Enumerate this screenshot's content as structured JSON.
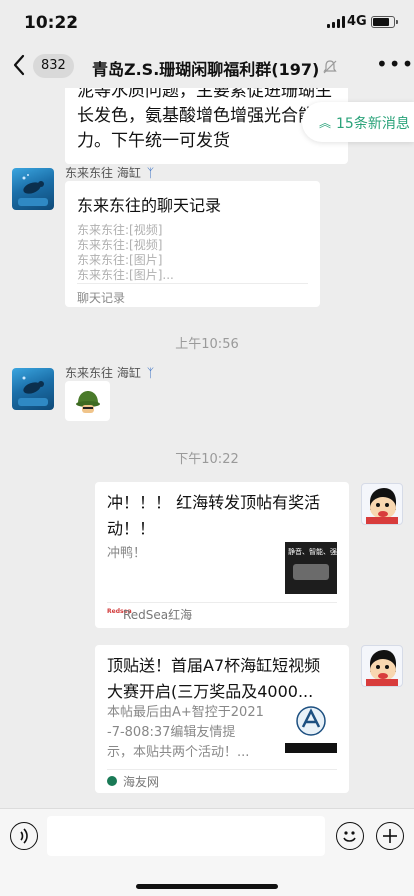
{
  "status": {
    "time": "10:22",
    "network": "4G"
  },
  "header": {
    "unread_count": "832",
    "title": "青岛Z.S.珊瑚闲聊福利群(197)"
  },
  "new_messages": {
    "label": "15条新消息"
  },
  "messages": {
    "top_bubble": {
      "line1": "泥等水质问题，主要累促进珊瑚生",
      "line2": "长发色，氨基酸增色增强光合能",
      "line3": "力。下午统一可发货"
    },
    "forward": {
      "sender": "东来东往 海缸",
      "title": "东来东往的聊天记录",
      "lines": [
        "东来东往:[视频]",
        "东来东往:[视频]",
        "东来东往:[图片]",
        "东来东往:[图片]..."
      ],
      "footer": "聊天记录"
    },
    "time1": "上午10:56",
    "emoji_msg": {
      "sender": "东来东往 海缸"
    },
    "time2": "下午10:22",
    "link1": {
      "title": "冲！！！ 红海转发顶帖有奖活动！！",
      "desc": "冲鸭！",
      "thumb_text": "静音、智能、强劲",
      "source": "RedSea红海",
      "source_logo": "Redsea"
    },
    "link2": {
      "title": "顶贴送！首届A7杯海缸短视频大赛开启(三万奖品及4000...",
      "desc_line1": "本帖最后由A+智控于2021",
      "desc_line2": "-7-808:37编辑友情提",
      "desc_line3": "示，本贴共两个活动！...",
      "source": "海友网"
    }
  },
  "input": {
    "placeholder": ""
  },
  "colors": {
    "background": "#ededed",
    "accent": "#2ba37a",
    "bubble": "#ffffff",
    "time_text": "#9a9a9a"
  }
}
